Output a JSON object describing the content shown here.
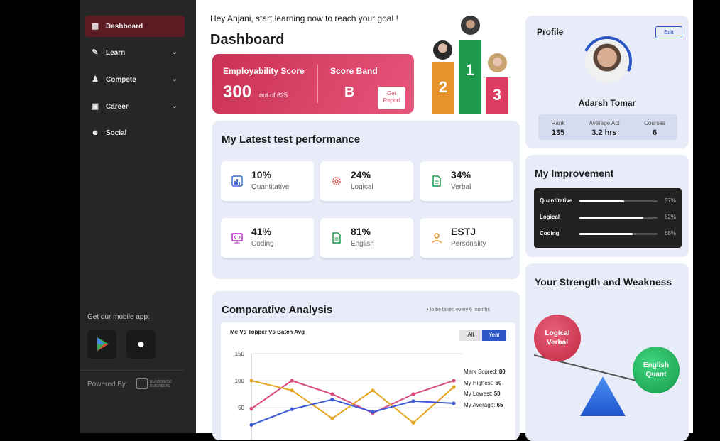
{
  "sidebar": {
    "items": [
      {
        "label": "Dashboard",
        "icon": "dashboard-icon"
      },
      {
        "label": "Learn",
        "icon": "learn-icon"
      },
      {
        "label": "Compete",
        "icon": "compete-icon"
      },
      {
        "label": "Career",
        "icon": "career-icon"
      },
      {
        "label": "Social",
        "icon": "social-icon"
      }
    ],
    "mobile_label": "Get our mobile app:",
    "powered": "Powered By:",
    "brand_line1": "BLACKBUCK",
    "brand_line2": "ENGINEERS"
  },
  "header": {
    "greeting": "Hey Anjani, start learning now to reach your goal !",
    "title": "Dashboard"
  },
  "score": {
    "label": "Employability Score",
    "value": "300",
    "outof": "out of 625",
    "band_label": "Score Band",
    "band": "B",
    "report1": "Get",
    "report2": "Report"
  },
  "podium": {
    "first": "1",
    "second": "2",
    "third": "3"
  },
  "performance": {
    "title": "My Latest test performance",
    "tiles": [
      {
        "value": "10%",
        "label": "Quantitative"
      },
      {
        "value": "24%",
        "label": "Logical"
      },
      {
        "value": "34%",
        "label": "Verbal"
      },
      {
        "value": "41%",
        "label": "Coding"
      },
      {
        "value": "81%",
        "label": "English"
      },
      {
        "value": "ESTJ",
        "label": "Personality"
      }
    ]
  },
  "analysis": {
    "title": "Comparative Analysis",
    "note": "to be taken every 6 months",
    "chart_title": "Me Vs Topper Vs Batch Avg",
    "toggle_all": "All",
    "toggle_year": "Year",
    "stats": [
      {
        "label": "Mark Scored:",
        "value": "80"
      },
      {
        "label": "My Highest:",
        "value": "60"
      },
      {
        "label": "My Lowest:",
        "value": "50"
      },
      {
        "label": "My Average:",
        "value": "65"
      }
    ]
  },
  "chart_data": {
    "type": "line",
    "yticks": [
      "150",
      "100",
      "50"
    ],
    "ylim": [
      0,
      150
    ],
    "series": [
      {
        "values": [
          48,
          100,
          75,
          40,
          75,
          100
        ],
        "color": "#d94a7a"
      },
      {
        "values": [
          100,
          82,
          30,
          82,
          22,
          88
        ],
        "color": "#e6a622"
      },
      {
        "values": [
          18,
          47,
          65,
          42,
          62,
          58
        ],
        "color": "#3b5bd6"
      }
    ]
  },
  "profile": {
    "title": "Profile",
    "edit": "Edit",
    "name": "Adarsh Tomar",
    "stats": [
      {
        "label": "Rank",
        "value": "135"
      },
      {
        "label": "Average Act",
        "value": "3.2 hrs"
      },
      {
        "label": "Courses",
        "value": "6"
      }
    ]
  },
  "improvement": {
    "title": "My Improvement",
    "rows": [
      {
        "label": "Quantitative",
        "pct": "57%",
        "fill": 0.57
      },
      {
        "label": "Logical",
        "pct": "82%",
        "fill": 0.82
      },
      {
        "label": "Coding",
        "pct": "68%",
        "fill": 0.68
      }
    ]
  },
  "strength": {
    "title": "Your Strength and Weakness",
    "left1": "Logical",
    "left2": "Verbal",
    "right1": "English",
    "right2": "Quant"
  },
  "colors": {
    "accent": "#d93a5f",
    "sidebar": "#262626",
    "active": "#5a1c22"
  }
}
